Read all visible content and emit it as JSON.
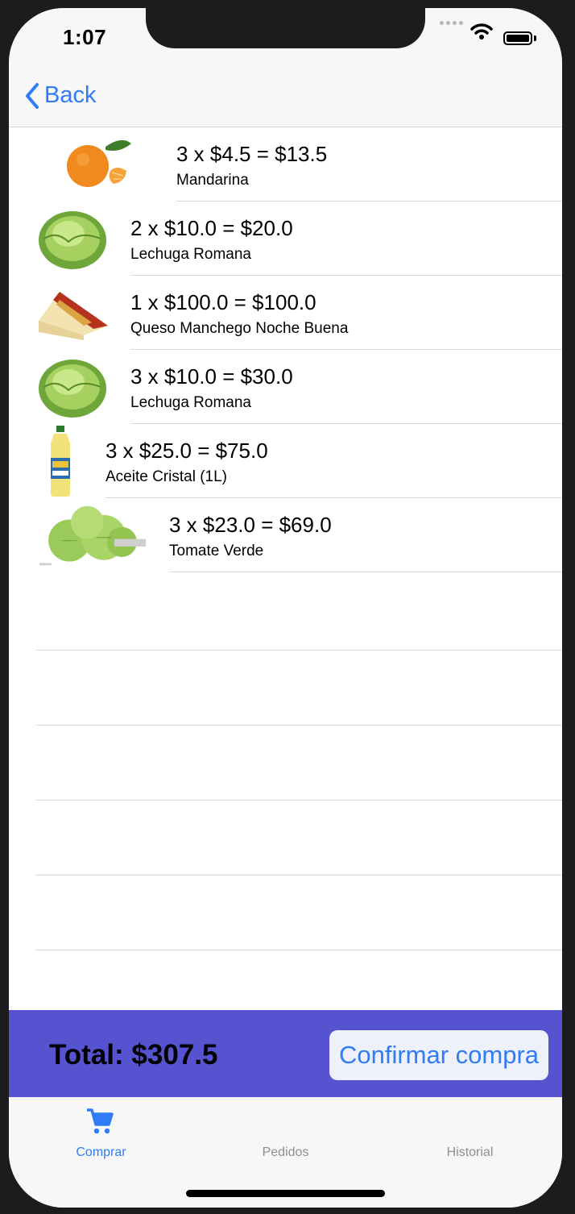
{
  "status_bar": {
    "time": "1:07"
  },
  "navbar": {
    "back_label": "Back"
  },
  "items": [
    {
      "qty_line": "3 x $4.5 = $13.5",
      "name": "Mandarina",
      "image": "mandarin-icon"
    },
    {
      "qty_line": "2 x $10.0 = $20.0",
      "name": "Lechuga Romana",
      "image": "lettuce-icon"
    },
    {
      "qty_line": "1 x $100.0 = $100.0",
      "name": "Queso Manchego Noche Buena",
      "image": "cheese-icon"
    },
    {
      "qty_line": "3 x $10.0 = $30.0",
      "name": "Lechuga Romana",
      "image": "lettuce-icon"
    },
    {
      "qty_line": "3 x $25.0 = $75.0",
      "name": "Aceite Cristal (1L)",
      "image": "oil-bottle-icon"
    },
    {
      "qty_line": "3 x $23.0 = $69.0",
      "name": "Tomate Verde",
      "image": "green-tomato-icon"
    }
  ],
  "checkout": {
    "total_label": "Total: $307.5",
    "confirm_label": "Confirmar compra"
  },
  "tabs": [
    {
      "label": "Comprar",
      "active": true
    },
    {
      "label": "Pedidos",
      "active": false
    },
    {
      "label": "Historial",
      "active": false
    }
  ],
  "colors": {
    "accent": "#2f7cf6",
    "checkout_bar": "#5653d0",
    "inactive_tab": "#8e8e93"
  }
}
